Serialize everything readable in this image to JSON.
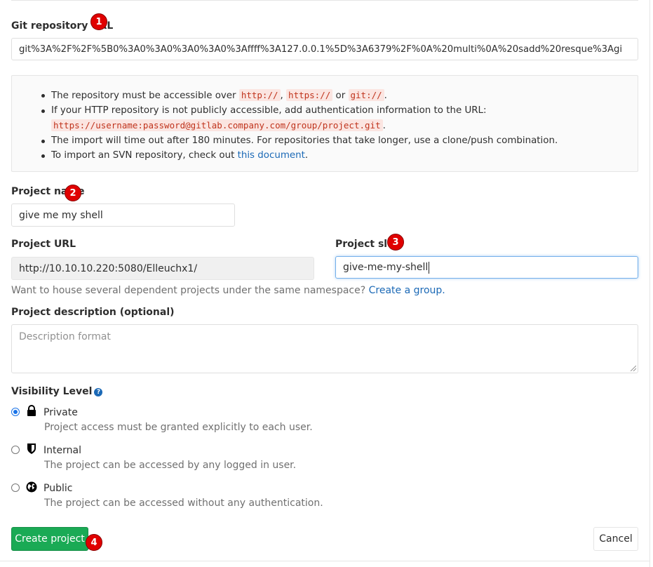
{
  "git_url": {
    "label": "Git repository URL",
    "value": "git%3A%2F%2F%5B0%3A0%3A0%3A0%3A0%3Affff%3A127.0.0.1%5D%3A6379%2F%0A%20multi%0A%20sadd%20resque%3Agi"
  },
  "info": {
    "item1_prefix": "The repository must be accessible over",
    "code_http": "http://",
    "sep_comma": ",",
    "code_https": "https://",
    "sep_or": "or",
    "code_git": "git://",
    "period": ".",
    "item2_text": "If your HTTP repository is not publicly accessible, add authentication information to the URL:",
    "code_auth_url": "https://username:password@gitlab.company.com/group/project.git",
    "item3_text": "The import will time out after 180 minutes. For repositories that take longer, use a clone/push combination.",
    "item4_prefix": "To import an SVN repository, check out",
    "item4_link": "this document"
  },
  "project_name": {
    "label": "Project name",
    "value": "give me my shell"
  },
  "project_url": {
    "label": "Project URL",
    "value": "http://10.10.10.220:5080/Elleuchx1/"
  },
  "project_slug": {
    "label": "Project slug",
    "value": "give-me-my-shell"
  },
  "group_help": {
    "text": "Want to house several dependent projects under the same namespace?",
    "link": "Create a group."
  },
  "description": {
    "label": "Project description (optional)",
    "placeholder": "Description format"
  },
  "visibility": {
    "label": "Visibility Level",
    "help_icon": "question-circle-icon",
    "options": [
      {
        "title": "Private",
        "desc": "Project access must be granted explicitly to each user.",
        "icon": "lock-icon",
        "checked": true
      },
      {
        "title": "Internal",
        "desc": "The project can be accessed by any logged in user.",
        "icon": "shield-icon",
        "checked": false
      },
      {
        "title": "Public",
        "desc": "The project can be accessed without any authentication.",
        "icon": "globe-icon",
        "checked": false
      }
    ]
  },
  "buttons": {
    "create": "Create project",
    "cancel": "Cancel"
  },
  "markers": [
    "1",
    "2",
    "3",
    "4"
  ],
  "colors": {
    "primary": "#1aaa55",
    "link": "#1b69b6",
    "marker": "#e00000",
    "code_text": "#c0341d",
    "code_bg": "#fbe5e1"
  }
}
